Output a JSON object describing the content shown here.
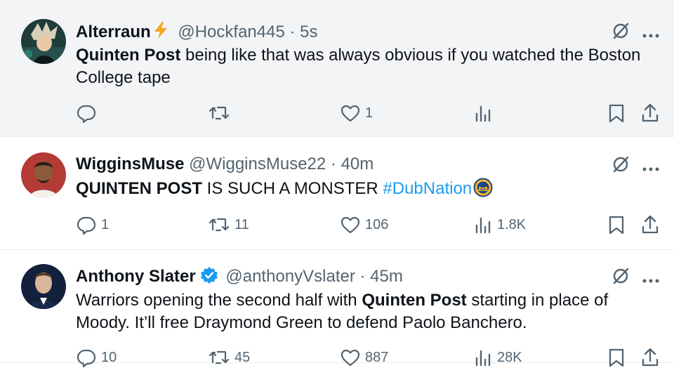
{
  "tweets": [
    {
      "name": "Alterraun",
      "handle": "@Hockfan445",
      "dot": "·",
      "time": "5s",
      "text_parts": [
        {
          "t": "Quinten Post",
          "bold": true
        },
        {
          "t": " being like that was always obvious if you watched the Boston College tape"
        }
      ],
      "counts": {
        "reply": "",
        "retweet": "",
        "like": "1",
        "views": ""
      }
    },
    {
      "name": "WigginsMuse",
      "handle": "@WigginsMuse22",
      "dot": "·",
      "time": "40m",
      "text_parts": [
        {
          "t": "QUINTEN POST",
          "bold": true
        },
        {
          "t": " IS SUCH A MONSTER "
        },
        {
          "t": "#DubNation",
          "hashtag": true
        }
      ],
      "counts": {
        "reply": "1",
        "retweet": "11",
        "like": "106",
        "views": "1.8K"
      }
    },
    {
      "name": "Anthony Slater",
      "handle": "@anthonyVslater",
      "dot": "·",
      "time": "45m",
      "text_parts": [
        {
          "t": "Warriors opening the second half with "
        },
        {
          "t": "Quinten Post",
          "bold": true
        },
        {
          "t": " starting in place of Moody. It’ll free Draymond Green to defend Paolo Banchero."
        }
      ],
      "counts": {
        "reply": "10",
        "retweet": "45",
        "like": "887",
        "views": "28K"
      }
    }
  ],
  "colors": {
    "accent": "#1d9bf0",
    "muted": "#536471",
    "text": "#0f1419",
    "highlight_bg": "#f3f4f6"
  },
  "icons": [
    "lightning-icon",
    "verified-badge-icon",
    "warriors-logo-icon",
    "grok-icon",
    "more-icon",
    "reply-icon",
    "retweet-icon",
    "like-icon",
    "views-icon",
    "bookmark-icon",
    "share-icon"
  ]
}
